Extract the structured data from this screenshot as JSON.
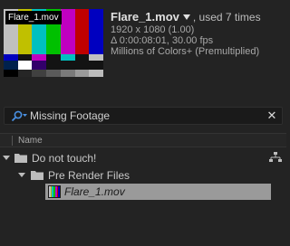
{
  "thumbnail": {
    "label": "Flare_1.mov",
    "bar_colors": [
      "#c0c0c0",
      "#c0c000",
      "#00c0c0",
      "#00c000",
      "#c000c0",
      "#c00000",
      "#0000c0"
    ],
    "row2_colors": [
      "#0000c0",
      "#131313",
      "#c000c0",
      "#131313",
      "#00c0c0",
      "#131313",
      "#c0c0c0"
    ],
    "row3_colors": [
      "#00214c",
      "#ffffff",
      "#32006a",
      "#131313",
      "#131313",
      "#131313",
      "#131313"
    ],
    "row4_colors": [
      "#000000",
      "#262626",
      "#404040",
      "#5a5a5a",
      "#7a7a7a",
      "#9a9a9a",
      "#bcbcbc"
    ]
  },
  "info": {
    "filename": "Flare_1.mov",
    "used": ", used 7 times",
    "resolution": "1920 x 1080 (1.00)",
    "duration": "Δ 0:00:08:01, 30.00 fps",
    "color_depth": "Millions of Colors+ (Premultiplied)"
  },
  "search": {
    "value": "Missing Footage",
    "placeholder": ""
  },
  "columns": {
    "name": "Name"
  },
  "tree": {
    "items": [
      {
        "label": "Do not touch!",
        "type": "folder"
      },
      {
        "label": "Pre Render Files",
        "type": "folder"
      },
      {
        "label": "Flare_1.mov",
        "type": "footage"
      }
    ]
  },
  "colors": {
    "background": "#232323",
    "selected_row": "#9a9a9a",
    "search_icon": "#4a90e2"
  }
}
